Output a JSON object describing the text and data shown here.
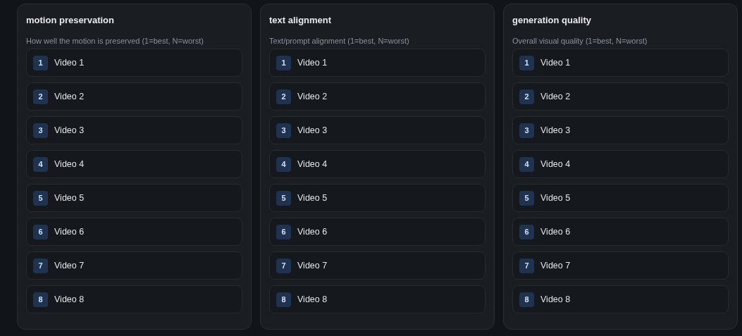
{
  "panels": [
    {
      "title": "motion preservation",
      "description": "How well the motion is preserved (1=best, N=worst)",
      "items": [
        {
          "rank": "1",
          "label": "Video 1"
        },
        {
          "rank": "2",
          "label": "Video 2"
        },
        {
          "rank": "3",
          "label": "Video 3"
        },
        {
          "rank": "4",
          "label": "Video 4"
        },
        {
          "rank": "5",
          "label": "Video 5"
        },
        {
          "rank": "6",
          "label": "Video 6"
        },
        {
          "rank": "7",
          "label": "Video 7"
        },
        {
          "rank": "8",
          "label": "Video 8"
        }
      ]
    },
    {
      "title": "text alignment",
      "description": "Text/prompt alignment (1=best, N=worst)",
      "items": [
        {
          "rank": "1",
          "label": "Video 1"
        },
        {
          "rank": "2",
          "label": "Video 2"
        },
        {
          "rank": "3",
          "label": "Video 3"
        },
        {
          "rank": "4",
          "label": "Video 4"
        },
        {
          "rank": "5",
          "label": "Video 5"
        },
        {
          "rank": "6",
          "label": "Video 6"
        },
        {
          "rank": "7",
          "label": "Video 7"
        },
        {
          "rank": "8",
          "label": "Video 8"
        }
      ]
    },
    {
      "title": "generation quality",
      "description": "Overall visual quality (1=best, N=worst)",
      "items": [
        {
          "rank": "1",
          "label": "Video 1"
        },
        {
          "rank": "2",
          "label": "Video 2"
        },
        {
          "rank": "3",
          "label": "Video 3"
        },
        {
          "rank": "4",
          "label": "Video 4"
        },
        {
          "rank": "5",
          "label": "Video 5"
        },
        {
          "rank": "6",
          "label": "Video 6"
        },
        {
          "rank": "7",
          "label": "Video 7"
        },
        {
          "rank": "8",
          "label": "Video 8"
        }
      ]
    }
  ]
}
